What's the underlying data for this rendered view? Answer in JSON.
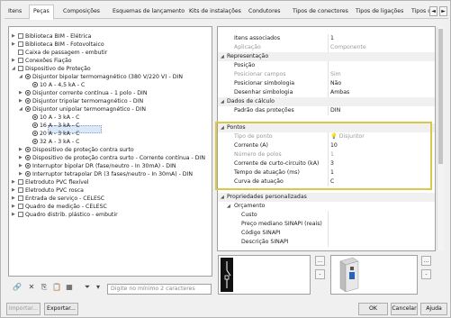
{
  "tabs": [
    "Itens",
    "Peças",
    "Composições",
    "Esquemas de lançamento",
    "Kits de instalações",
    "Condutores",
    "Tipos de conectores",
    "Tipos de ligações",
    "Tipos de"
  ],
  "tab_scroll": {
    "left": "◄",
    "right": "►"
  },
  "tree": [
    {
      "label": "Biblioteca BIM - Elétrica",
      "toggle": "▶"
    },
    {
      "label": "Biblioteca BIM - Fotovoltaico",
      "toggle": "▶"
    },
    {
      "label": "Caixa de passagem - embutir",
      "toggle": ""
    },
    {
      "label": "Conexões Fiação",
      "toggle": "▶"
    },
    {
      "label": "Dispositivo de Proteção",
      "toggle": "◢"
    },
    {
      "label": "Disjuntor bipolar termomagnético (380 V/220 V) - DIN",
      "toggle": "◢"
    },
    {
      "label": "10 A - 4,5 kA - C",
      "toggle": ""
    },
    {
      "label": "Disjuntor corrente contínua - 1 polo - DIN",
      "toggle": "▶"
    },
    {
      "label": "Disjuntor tripolar termomagnético - DIN",
      "toggle": "▶"
    },
    {
      "label": "Disjuntor unipolar termomagnético - DIN",
      "toggle": "◢"
    },
    {
      "label": "10 A - 3 kA - C",
      "toggle": ""
    },
    {
      "label": "16 A - 3 kA - C",
      "toggle": ""
    },
    {
      "label": "20 A - 3 kA - C",
      "toggle": ""
    },
    {
      "label": "32 A - 3 kA - C",
      "toggle": ""
    },
    {
      "label": "Dispositivo de proteção contra surto",
      "toggle": "▶"
    },
    {
      "label": "Dispositivo de proteção contra surto - Corrente contínua - DIN",
      "toggle": "▶"
    },
    {
      "label": "Interruptor bipolar DR (fase/neutro - In 30mA) - DIN",
      "toggle": "▶"
    },
    {
      "label": "Interruptor tetrapolar DR (3 fases/neutro - In 30mA) - DIN",
      "toggle": "▶"
    },
    {
      "label": "Eletroduto PVC flexível",
      "toggle": "▶"
    },
    {
      "label": "Eletroduto PVC rosca",
      "toggle": "▶"
    },
    {
      "label": "Entrada de serviço - CELESC",
      "toggle": "▶"
    },
    {
      "label": "Quadro de medição - CELESC",
      "toggle": "▶"
    },
    {
      "label": "Quadro distrib. plástico - embutir",
      "toggle": "▶"
    }
  ],
  "search_placeholder": "Digite no mínimo 2 caracteres",
  "props": [
    {
      "k": "Itens associados",
      "v": "1",
      "type": "row"
    },
    {
      "k": "Aplicação",
      "v": "Componente",
      "type": "grey"
    },
    {
      "k": "Representação",
      "v": "",
      "type": "cat"
    },
    {
      "k": "Posição",
      "v": "",
      "type": "row"
    },
    {
      "k": "Posicionar campos",
      "v": "Sim",
      "type": "grey"
    },
    {
      "k": "Posicionar simbologia",
      "v": "Não",
      "type": "row"
    },
    {
      "k": "Desenhar simbologia",
      "v": "Ambas",
      "type": "row"
    },
    {
      "k": "Dados de cálculo",
      "v": "",
      "type": "cat"
    },
    {
      "k": "Padrão das proteções",
      "v": "DIN",
      "type": "row"
    },
    {
      "k": "Pontos",
      "v": "",
      "type": "cat"
    },
    {
      "k": "Tipo de ponto",
      "v": "Disjuntor",
      "type": "grey"
    },
    {
      "k": "Corrente (A)",
      "v": "10",
      "type": "row"
    },
    {
      "k": "Número de polos",
      "v": "1",
      "type": "grey"
    },
    {
      "k": "Corrente de curto-circuito (kA)",
      "v": "3",
      "type": "row"
    },
    {
      "k": "Tempo de atuação (ms)",
      "v": "1",
      "type": "row"
    },
    {
      "k": "Curva de atuação",
      "v": "C",
      "type": "row"
    },
    {
      "k": "Propriedades personalizadas",
      "v": "",
      "type": "cat"
    },
    {
      "k": "Orçamento",
      "v": "",
      "type": "cat2"
    },
    {
      "k": "Custo",
      "v": "",
      "type": "sub"
    },
    {
      "k": "Preço mediano SINAPI (reais)",
      "v": "",
      "type": "sub"
    },
    {
      "k": "Código SINAPI",
      "v": "",
      "type": "sub"
    },
    {
      "k": "Descrição SINAPI",
      "v": "",
      "type": "sub"
    }
  ],
  "buttons": {
    "import": "Importar...",
    "export": "Exportar...",
    "ok": "OK",
    "cancel": "Cancelar",
    "help": "Ajuda"
  },
  "side_buttons": {
    "add": "...",
    "remove": "-"
  }
}
